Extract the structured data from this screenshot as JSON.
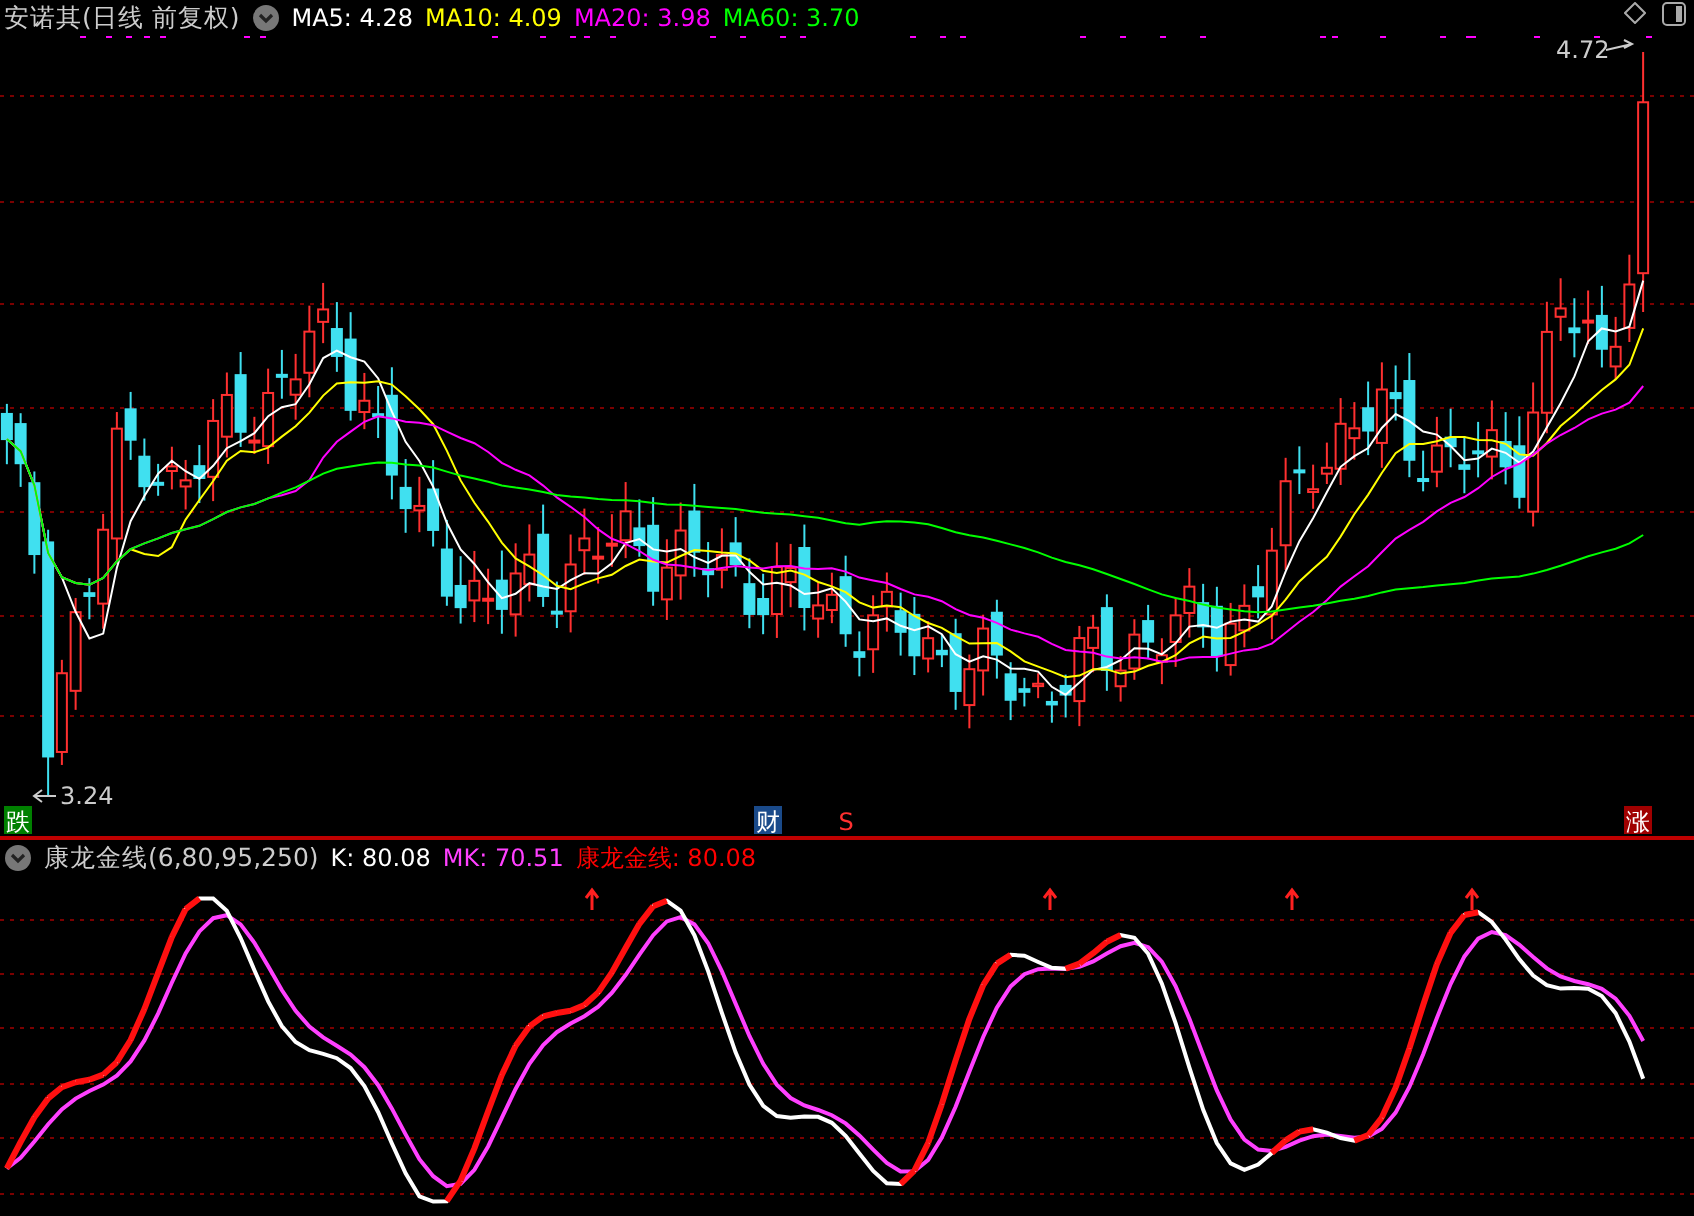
{
  "header": {
    "title": "安诺其(日线 前复权)",
    "ma_labels": [
      {
        "label": "MA5: 4.28",
        "color": "#ffffff"
      },
      {
        "label": "MA10: 4.09",
        "color": "#ffff00"
      },
      {
        "label": "MA20: 3.98",
        "color": "#ff00ff"
      },
      {
        "label": "MA60: 3.70",
        "color": "#00ff00"
      }
    ]
  },
  "price_chart": {
    "high_label": "4.72",
    "low_label": "3.24",
    "markers": [
      {
        "text": "跌",
        "kind": "fall"
      },
      {
        "text": "财",
        "kind": "finance"
      },
      {
        "text": "S",
        "kind": "signal"
      },
      {
        "text": "涨",
        "kind": "rise"
      }
    ]
  },
  "indicator": {
    "title": "康龙金线(6,80,95,250)",
    "values": [
      {
        "label": "K: 80.08",
        "color": "#ffffff"
      },
      {
        "label": "MK: 70.51",
        "color": "#ff40ff"
      },
      {
        "label": "康龙金线: 80.08",
        "color": "#ff0000"
      }
    ]
  }
}
